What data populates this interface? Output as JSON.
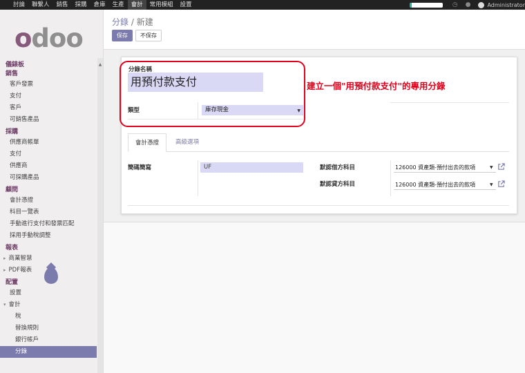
{
  "topbar": {
    "menu": [
      "討論",
      "聯繫人",
      "銷售",
      "採購",
      "倉庫",
      "生產",
      "會計",
      "常用模組",
      "設置"
    ],
    "active_menu": "會計",
    "user": "Administrator",
    "progress": 0.07,
    "icons": [
      "clock-icon",
      "chat-icon"
    ]
  },
  "sidebar": {
    "logo": "odoo",
    "sections": [
      {
        "title": "儀錶板",
        "items": []
      },
      {
        "title": "銷售",
        "items": [
          "客戶發票",
          "支付",
          "客戶",
          "可銷售產品"
        ]
      },
      {
        "title": "採購",
        "items": [
          "供應商帳單",
          "支付",
          "供應商",
          "可採購產品"
        ]
      },
      {
        "title": "顧問",
        "items": [
          "會計憑證",
          "科目一覽表",
          "手動進行支付和發票匹配",
          "採用手動稅調整"
        ]
      },
      {
        "title": "報表",
        "items": [
          "商業智慧",
          "PDF報表"
        ]
      },
      {
        "title": "配置",
        "items": [
          "設置",
          "會計",
          "稅",
          "替換規則",
          "銀行帳戶",
          "分錄"
        ]
      }
    ],
    "active_item": "分錄"
  },
  "control_panel": {
    "breadcrumb_parent": "分錄",
    "breadcrumb_sep": "/",
    "breadcrumb_current": "新建",
    "save_label": "保存",
    "discard_label": "不保存"
  },
  "form": {
    "name_label": "分錄名稱",
    "name_value": "用預付款支付",
    "type_label": "類型",
    "type_value": "庫存現金",
    "annotation": "建立一個\"用預付款支付\"的專用分錄",
    "tabs": [
      "會計憑證",
      "高級選項"
    ],
    "short_code_label": "簡碼簡寫",
    "short_code_value": "UF",
    "debit_label": "默認借方科目",
    "debit_value": "126000 資產類-預付出去的款項",
    "credit_label": "默認貸方科目",
    "credit_value": "126000 資產類-預付出去的款項"
  }
}
